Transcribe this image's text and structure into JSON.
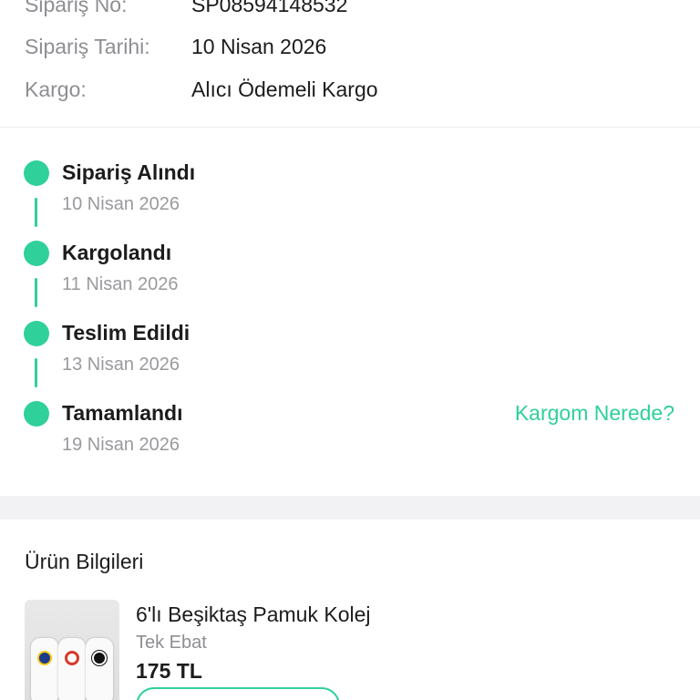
{
  "order": {
    "rows": [
      {
        "label": "Sipariş No:",
        "value": "SP08594148532"
      },
      {
        "label": "Sipariş Tarihi:",
        "value": "10 Nisan 2026"
      },
      {
        "label": "Kargo:",
        "value": "Alıcı Ödemeli Kargo"
      }
    ]
  },
  "timeline": {
    "steps": [
      {
        "title": "Sipariş Alındı",
        "date": "10 Nisan 2026"
      },
      {
        "title": "Kargolandı",
        "date": "11 Nisan 2026"
      },
      {
        "title": "Teslim Edildi",
        "date": "13 Nisan 2026"
      },
      {
        "title": "Tamamlandı",
        "date": "19 Nisan 2026"
      }
    ],
    "track_link": "Kargom Nerede?"
  },
  "product": {
    "section_title": "Ürün Bilgileri",
    "name": "6'lı Beşiktaş Pamuk Kolej",
    "variant": "Tek Ebat",
    "price": "175 TL"
  },
  "colors": {
    "accent": "#2fd09a",
    "separator": "#f2f2f4"
  }
}
